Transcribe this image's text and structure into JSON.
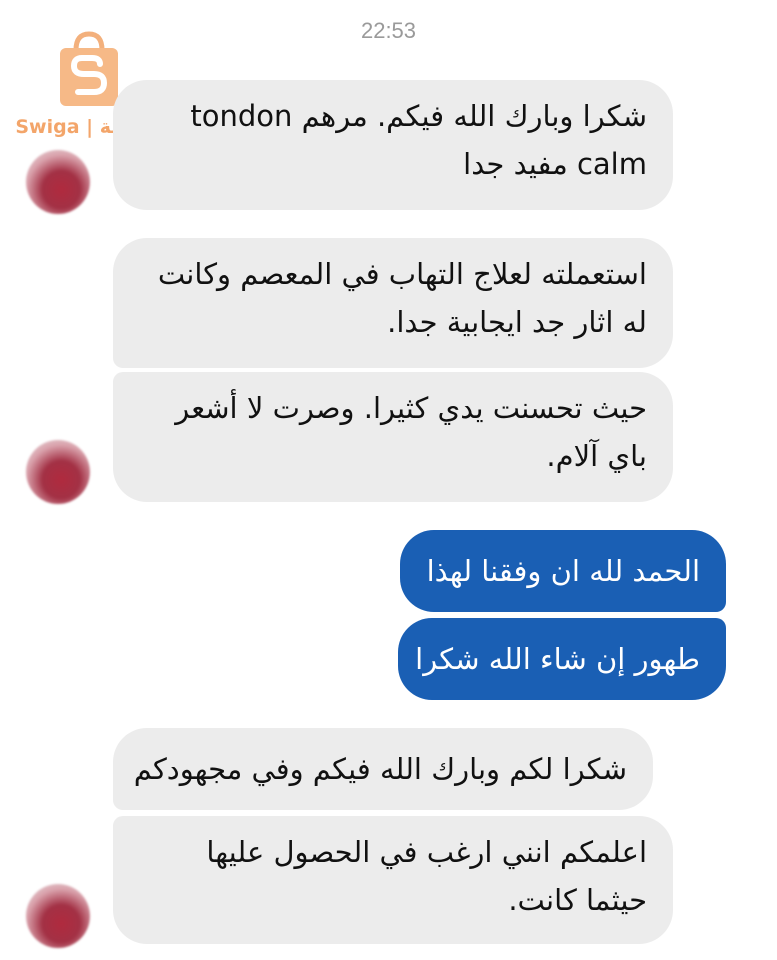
{
  "status": {
    "time": "22:53"
  },
  "watermark": {
    "text": "Swiga | سويقة"
  },
  "colors": {
    "incoming_bubble": "#ececec",
    "outgoing_bubble": "#1a5fb4",
    "watermark": "#f3a56a"
  },
  "messages": {
    "m1": {
      "line1": "شكرا وبارك الله فيكم.  مرهم tondon",
      "line2": "calm مفيد جدا"
    },
    "m2": {
      "line1": "استعملته لعلاج التهاب في المعصم وكانت",
      "line2": "له اثار جد ايجابية جدا."
    },
    "m3": {
      "line1": "حيث تحسنت يدي كثيرا. وصرت لا أشعر",
      "line2": "باي آلام."
    },
    "m4": {
      "line1": "الحمد لله ان وفقنا لهذا"
    },
    "m5": {
      "line1": "طهور إن شاء الله شكرا"
    },
    "m6": {
      "line1": "شكرا لكم وبارك الله فيكم وفي مجهودكم"
    },
    "m7": {
      "line1": "اعلمكم انني ارغب في الحصول عليها",
      "line2": "حيثما كانت."
    }
  }
}
